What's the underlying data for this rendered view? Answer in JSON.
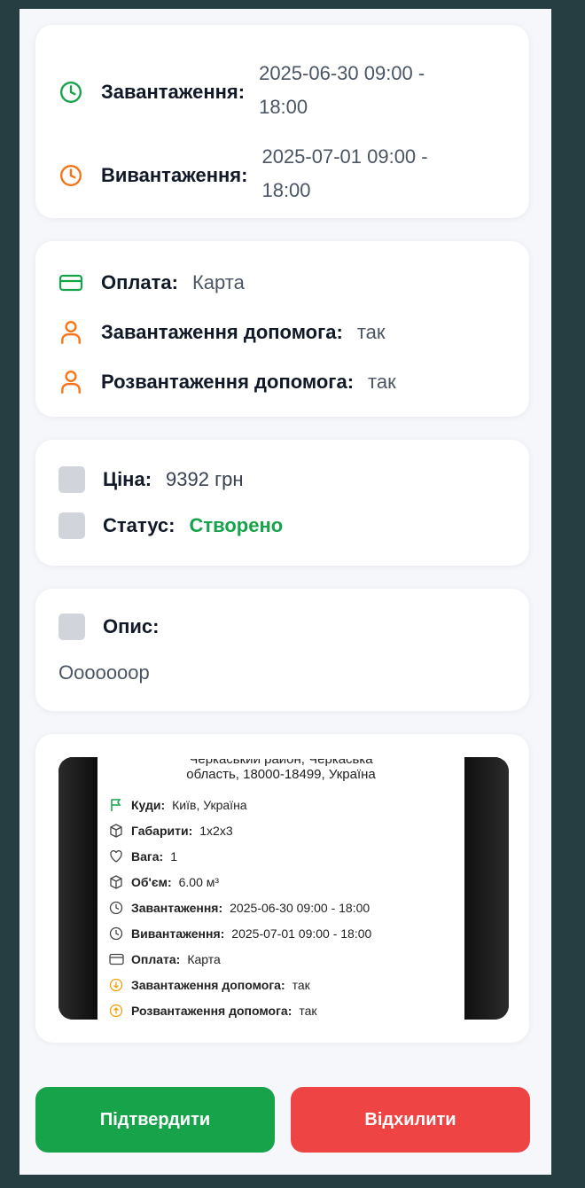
{
  "schedule": {
    "loading_label": "Завантаження:",
    "loading_value": "2025-06-30 09:00 - 18:00",
    "unloading_label": "Вивантаження:",
    "unloading_value": "2025-07-01 09:00 - 18:00"
  },
  "payment": {
    "payment_label": "Оплата:",
    "payment_value": "Карта",
    "load_help_label": "Завантаження допомога:",
    "load_help_value": "так",
    "unload_help_label": "Розвантаження допомога:",
    "unload_help_value": "так"
  },
  "price": {
    "price_label": "Ціна:",
    "price_value": "9392 грн",
    "status_label": "Статус:",
    "status_value": "Створено"
  },
  "description": {
    "label": "Опис:",
    "text": "Ооооооор"
  },
  "photo": {
    "header_line1": "Черкаський район, Черкаська",
    "header_line2": "область, 18000-18499, Україна",
    "items": [
      {
        "icon": "flag-icon",
        "label": "Куди:",
        "value": "Київ, Україна"
      },
      {
        "icon": "box-icon",
        "label": "Габарити:",
        "value": "1x2x3"
      },
      {
        "icon": "scale-icon",
        "label": "Вага:",
        "value": "1"
      },
      {
        "icon": "box-icon",
        "label": "Об'єм:",
        "value": "6.00 м³"
      },
      {
        "icon": "clock-icon",
        "label": "Завантаження:",
        "value": "2025-06-30 09:00 - 18:00"
      },
      {
        "icon": "clock-icon",
        "label": "Вивантаження:",
        "value": "2025-07-01 09:00 - 18:00"
      },
      {
        "icon": "card-icon",
        "label": "Оплата:",
        "value": "Карта"
      },
      {
        "icon": "arrow-down-circle-icon",
        "label": "Завантаження допомога:",
        "value": "так"
      },
      {
        "icon": "arrow-up-circle-icon",
        "label": "Розвантаження допомога:",
        "value": "так"
      }
    ]
  },
  "actions": {
    "confirm_label": "Підтвердити",
    "reject_label": "Відхилити"
  },
  "colors": {
    "green": "#16a34a",
    "orange": "#f97316",
    "red": "#ef4444",
    "placeholder": "#d1d5db"
  }
}
